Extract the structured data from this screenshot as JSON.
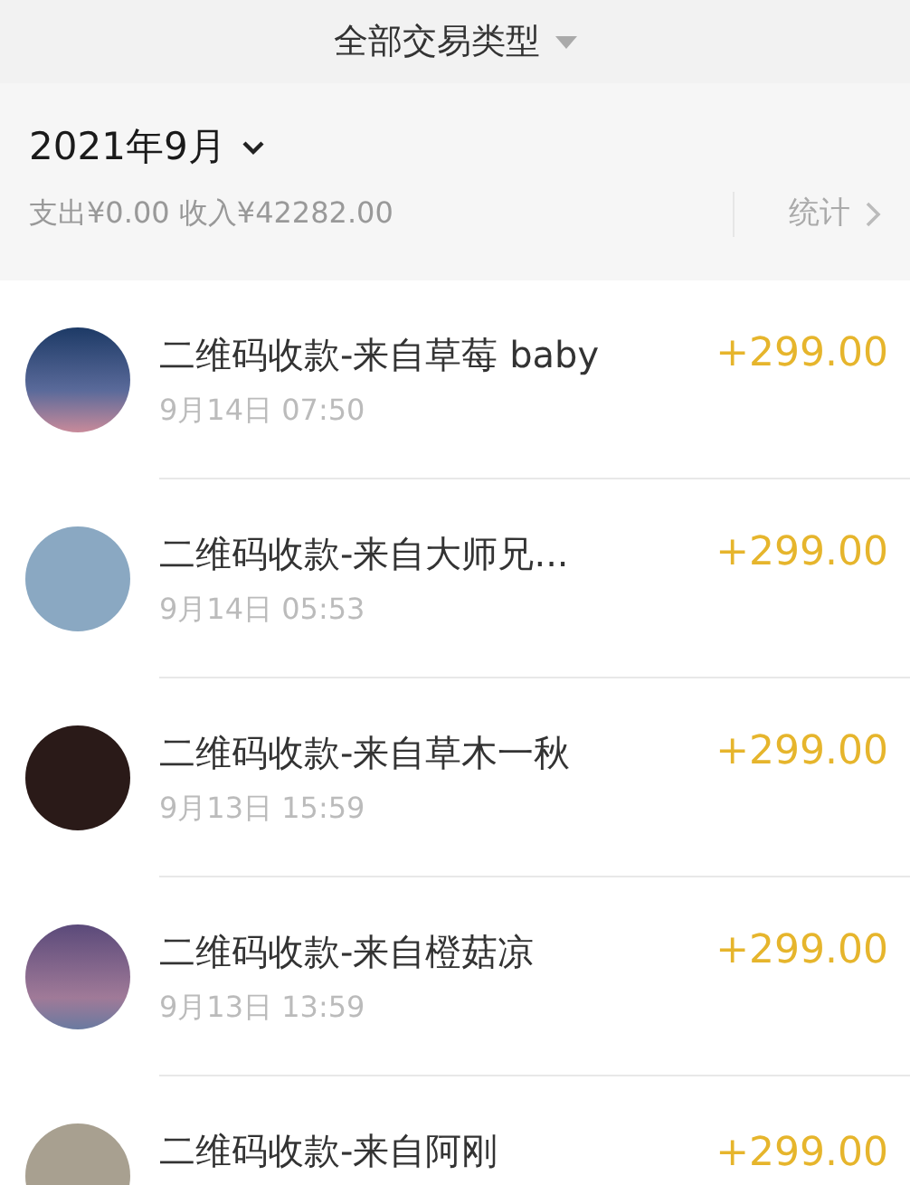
{
  "header": {
    "title": "全部交易类型"
  },
  "summary": {
    "month": "2021年9月",
    "totals": "支出¥0.00 收入¥42282.00",
    "stats_link": "统计"
  },
  "transactions": [
    {
      "title": "二维码收款-来自草莓 baby",
      "time": "9月14日 07:50",
      "amount": "+299.00"
    },
    {
      "title": "二维码收款-来自大师兄...",
      "time": "9月14日 05:53",
      "amount": "+299.00"
    },
    {
      "title": "二维码收款-来自草木一秋",
      "time": "9月13日 15:59",
      "amount": "+299.00"
    },
    {
      "title": "二维码收款-来自橙菇凉",
      "time": "9月13日 13:59",
      "amount": "+299.00"
    },
    {
      "title": "二维码收款-来自阿刚",
      "amount": "+299.00"
    }
  ]
}
